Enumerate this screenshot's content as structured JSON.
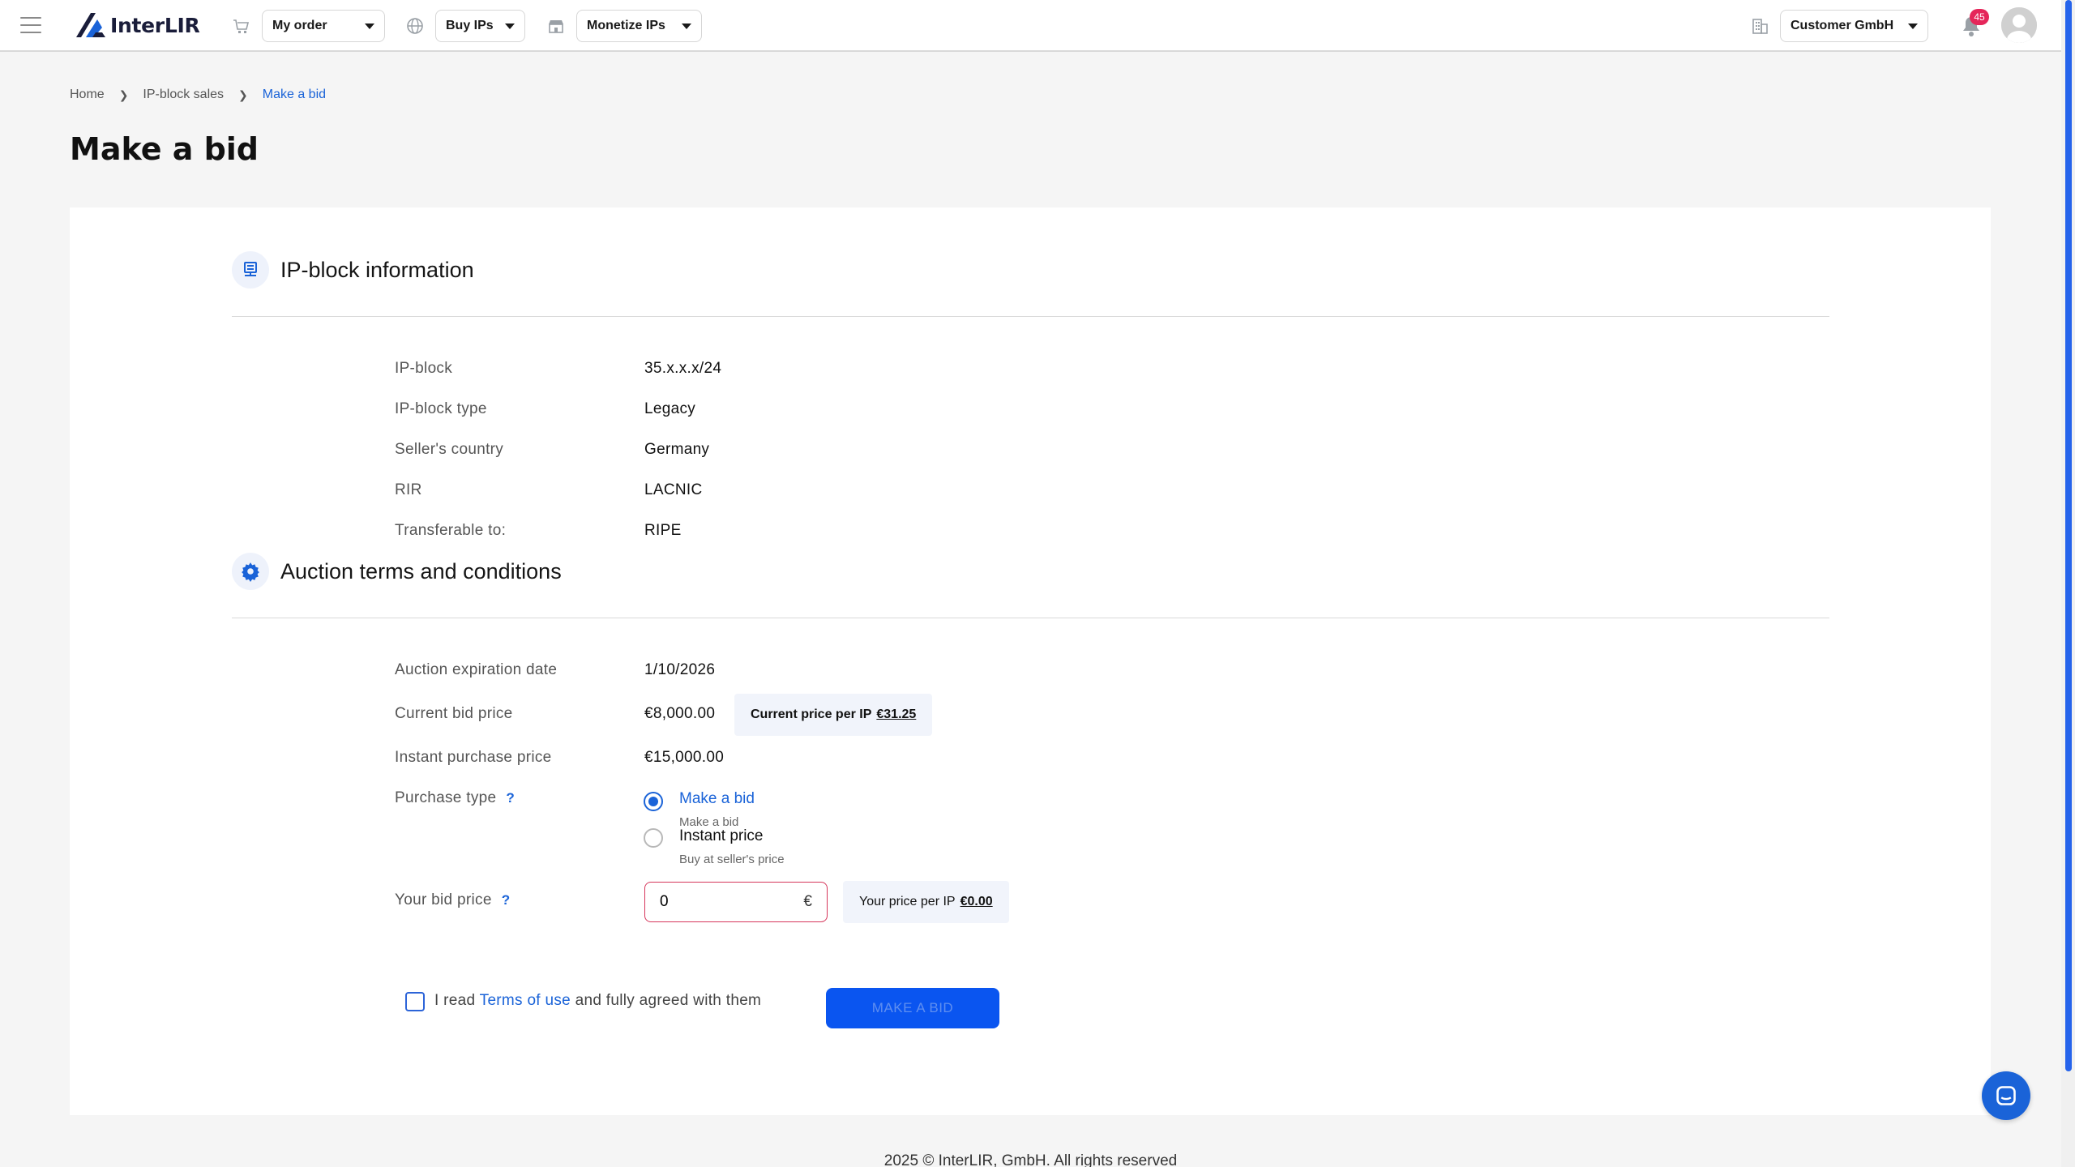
{
  "header": {
    "logo_text": "InterLIR",
    "order_dropdown": "My order",
    "buy_dropdown": "Buy IPs",
    "monetize_dropdown": "Monetize IPs",
    "company_dropdown": "Customer GmbH",
    "notification_count": "45",
    "accent_color": "#1a63d8"
  },
  "breadcrumb": {
    "home": "Home",
    "sales": "IP-block sales",
    "current": "Make a bid"
  },
  "page_title": "Make a bid",
  "ip_block_section": {
    "title": "IP-block information",
    "rows": [
      {
        "label": "IP-block",
        "value": "35.x.x.x/24"
      },
      {
        "label": "IP-block type",
        "value": "Legacy"
      },
      {
        "label": "Seller's country",
        "value": "Germany"
      },
      {
        "label": "RIR",
        "value": "LACNIC"
      },
      {
        "label": "Transferable to:",
        "value": "RIPE"
      }
    ]
  },
  "auction_section": {
    "title": "Auction terms and conditions",
    "expiration_label": "Auction expiration date",
    "expiration_value": "1/10/2026",
    "current_bid_label": "Current bid price",
    "current_bid_value": "€8,000.00",
    "current_price_per_ip_label": "Current price per IP",
    "current_price_per_ip_value": "€31.25",
    "instant_label": "Instant purchase price",
    "instant_value": "€15,000.00",
    "purchase_type_label": "Purchase type",
    "help_symbol": "?",
    "option_bid_title": "Make a bid",
    "option_bid_sub": "Make a bid",
    "option_instant_title": "Instant price",
    "option_instant_sub": "Buy at seller's price",
    "your_bid_label": "Your bid price",
    "your_bid_value": "0",
    "currency_symbol": "€",
    "your_price_per_ip_label": "Your price per IP",
    "your_price_per_ip_value": "€0.00"
  },
  "terms": {
    "prefix": "I read",
    "link": "Terms of use",
    "suffix": "and fully agreed with them"
  },
  "submit_label": "MAKE A BID",
  "footer": "2025 © InterLIR, GmbH. All rights reserved"
}
